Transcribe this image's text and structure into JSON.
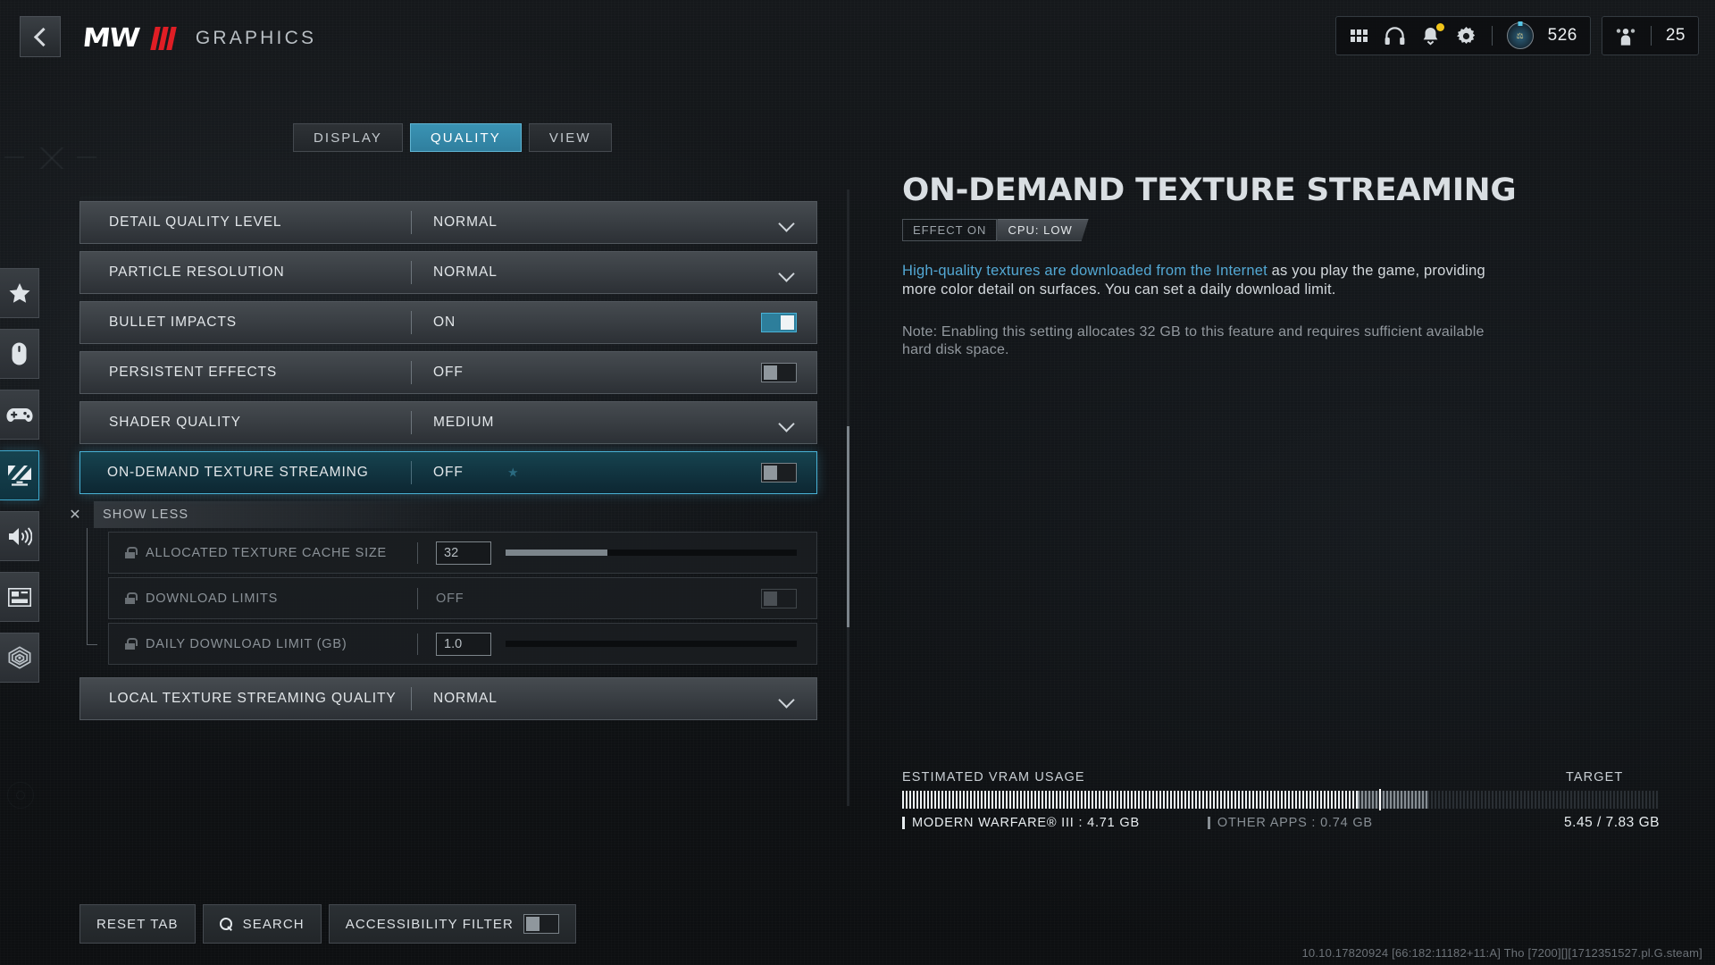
{
  "header": {
    "back_icon": "back-chevron-icon",
    "logo_text": "MW",
    "title": "GRAPHICS",
    "hud": {
      "grid_icon": "grid-menu-icon",
      "headphones_icon": "headphones-icon",
      "bell_icon": "notification-bell-icon",
      "gear_icon": "settings-gear-icon",
      "emblem_icon": "player-emblem-icon",
      "currency_value": "526",
      "squad_icon": "squad-members-icon",
      "squad_value": "25"
    }
  },
  "rail": {
    "items": [
      {
        "icon": "star-icon",
        "name": "favorites",
        "active": false
      },
      {
        "icon": "mouse-icon",
        "name": "mouse-keyboard",
        "active": false
      },
      {
        "icon": "gamepad-icon",
        "name": "controller",
        "active": false
      },
      {
        "icon": "monitor-icon",
        "name": "graphics",
        "active": true
      },
      {
        "icon": "speaker-icon",
        "name": "audio",
        "active": false
      },
      {
        "icon": "interface-icon",
        "name": "interface",
        "active": false
      },
      {
        "icon": "telemetry-icon",
        "name": "telemetry",
        "active": false
      }
    ]
  },
  "tabs": [
    {
      "label": "DISPLAY",
      "active": false
    },
    {
      "label": "QUALITY",
      "active": true
    },
    {
      "label": "VIEW",
      "active": false
    }
  ],
  "settings": {
    "rows": [
      {
        "label": "DETAIL QUALITY LEVEL",
        "value": "NORMAL",
        "control": "dropdown"
      },
      {
        "label": "PARTICLE RESOLUTION",
        "value": "NORMAL",
        "control": "dropdown"
      },
      {
        "label": "BULLET IMPACTS",
        "value": "ON",
        "control": "toggle",
        "toggle_state": "on"
      },
      {
        "label": "PERSISTENT EFFECTS",
        "value": "OFF",
        "control": "toggle",
        "toggle_state": "off"
      },
      {
        "label": "SHADER QUALITY",
        "value": "MEDIUM",
        "control": "dropdown"
      }
    ],
    "selected_row": {
      "label": "ON-DEMAND TEXTURE STREAMING",
      "value": "OFF",
      "control": "toggle",
      "toggle_state": "off",
      "star_icon": "star-marker-icon"
    },
    "show_less": {
      "label": "SHOW LESS",
      "close_icon": "close-x-icon"
    },
    "sub_rows": [
      {
        "label": "ALLOCATED TEXTURE CACHE SIZE",
        "value": "32",
        "control": "slider",
        "slider_fill_percent": 35,
        "lock_icon": "lock-icon"
      },
      {
        "label": "DOWNLOAD LIMITS",
        "value": "OFF",
        "control": "toggle",
        "toggle_state": "off",
        "lock_icon": "lock-icon"
      },
      {
        "label": "DAILY DOWNLOAD LIMIT (GB)",
        "value": "1.0",
        "control": "slider",
        "slider_fill_percent": 0,
        "lock_icon": "lock-icon"
      }
    ],
    "last_row": {
      "label": "LOCAL TEXTURE STREAMING QUALITY",
      "value": "NORMAL",
      "control": "dropdown"
    }
  },
  "detail": {
    "title": "ON-DEMAND TEXTURE STREAMING",
    "badge_effect": "EFFECT ON",
    "badge_cpu": "CPU: LOW",
    "desc_highlight": "High-quality textures are downloaded from the Internet",
    "desc_rest": " as you play the game, providing more color detail on surfaces. You can set a daily download limit.",
    "note": "Note: Enabling this setting allocates 32 GB to this feature and requires sufficient available hard disk space."
  },
  "vram": {
    "heading": "ESTIMATED VRAM USAGE",
    "target_label": "TARGET",
    "app_legend": "MODERN WARFARE® III : 4.71 GB",
    "other_legend": "OTHER APPS : 0.74 GB",
    "total": "5.45 / 7.83 GB",
    "app_gb": 4.71,
    "other_gb": 0.74,
    "used_gb": 5.45,
    "capacity_gb": 7.83,
    "target_position_percent": 63
  },
  "footer": {
    "reset_tab": "RESET TAB",
    "search": "SEARCH",
    "search_icon": "magnifier-icon",
    "accessibility_filter": "ACCESSIBILITY FILTER",
    "accessibility_state": "off"
  },
  "build_string": "10.10.17820924 [66:182:11182+11:A] Tho [7200][][1712351527.pl.G.steam]",
  "colors": {
    "accent": "#49b2d6",
    "accent_tab": "#3a93b4",
    "logo_red": "#e01e25",
    "notification": "#f0c419"
  }
}
